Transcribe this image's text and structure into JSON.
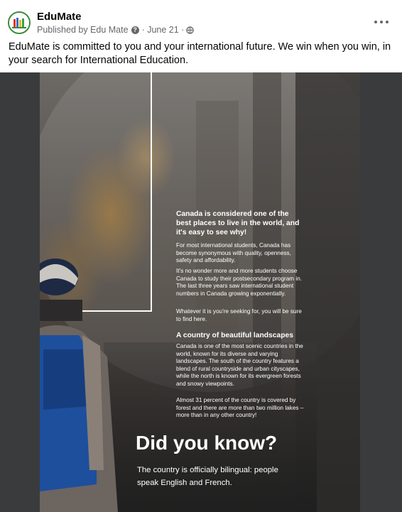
{
  "post": {
    "page_name": "EduMate",
    "published_by": "Published by Edu Mate",
    "date": "June 21",
    "caption": "EduMate is committed to you and your international future. We win when you win, in your search for International Education."
  },
  "image": {
    "heading1": "Canada is considered one of the best places to live in the world, and it's easy to see why!",
    "para1": "For most international students, Canada has become synonymous with quality,  openness, safety and affordability.",
    "para2": "It's no wonder more and more students choose Canada to study their postsecondary program in. The last three years saw international student numbers in Canada growing exponentially.",
    "para3": "Whatever it is you're seeking for, you will be sure to find here.",
    "heading2": "A country of beautiful landscapes",
    "para4": "Canada is one of the most scenic countries in the world, known for its diverse and varying landscapes. The south of the country features a blend of rural countryside and urban cityscapes, while the north is known for its evergreen forests and snowy viewpoints.",
    "para5": "Almost 31 percent of the country is covered by forest and there are more than two million lakes – more than in any other country!",
    "did_you_know": "Did you know?",
    "fact": "The country is officially bilingual: people speak English and French."
  },
  "icons": {
    "privacy": "globe-icon",
    "info": "question-icon",
    "menu": "more-options-icon"
  }
}
